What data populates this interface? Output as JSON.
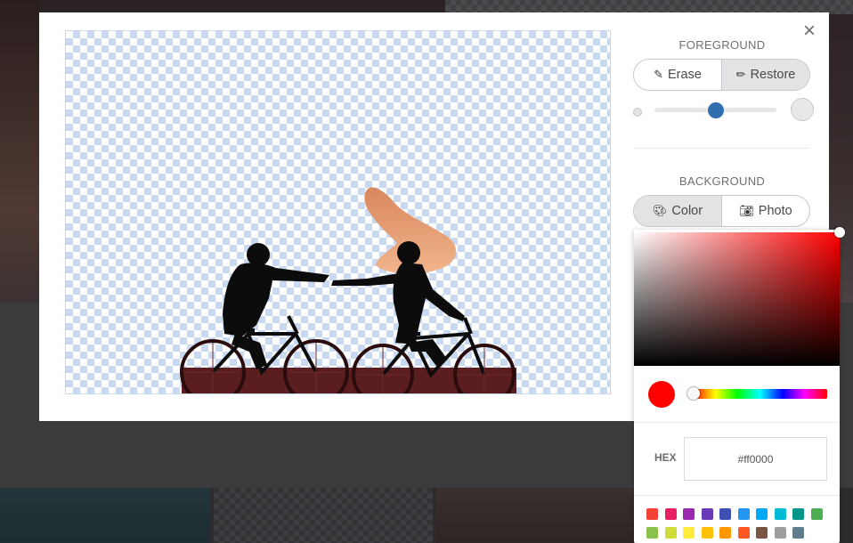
{
  "modal": {
    "close_icon": "close-icon (×)",
    "close_glyph": "×"
  },
  "foreground": {
    "title": "FOREGROUND",
    "erase_label": "Erase",
    "restore_label": "Restore",
    "active": "Restore",
    "brush_size_fraction": 0.5
  },
  "background": {
    "title": "BACKGROUND",
    "color_label": "Color",
    "photo_label": "Photo",
    "active": "Color"
  },
  "color_picker": {
    "selected_color": "#ff0000",
    "hex_label": "HEX",
    "hex_value": "#ff0000",
    "swatches_row1": [
      "#f44336",
      "#e91e63",
      "#9c27b0",
      "#673ab7",
      "#3f51b5",
      "#2196f3",
      "#03a9f4",
      "#00bcd4",
      "#009688",
      "#4caf50"
    ],
    "swatches_row2": [
      "#8bc34a",
      "#cddc39",
      "#ffeb3b",
      "#ffc107",
      "#ff9800",
      "#ff5722",
      "#795548",
      "#9e9e9e",
      "#607d8b"
    ]
  }
}
